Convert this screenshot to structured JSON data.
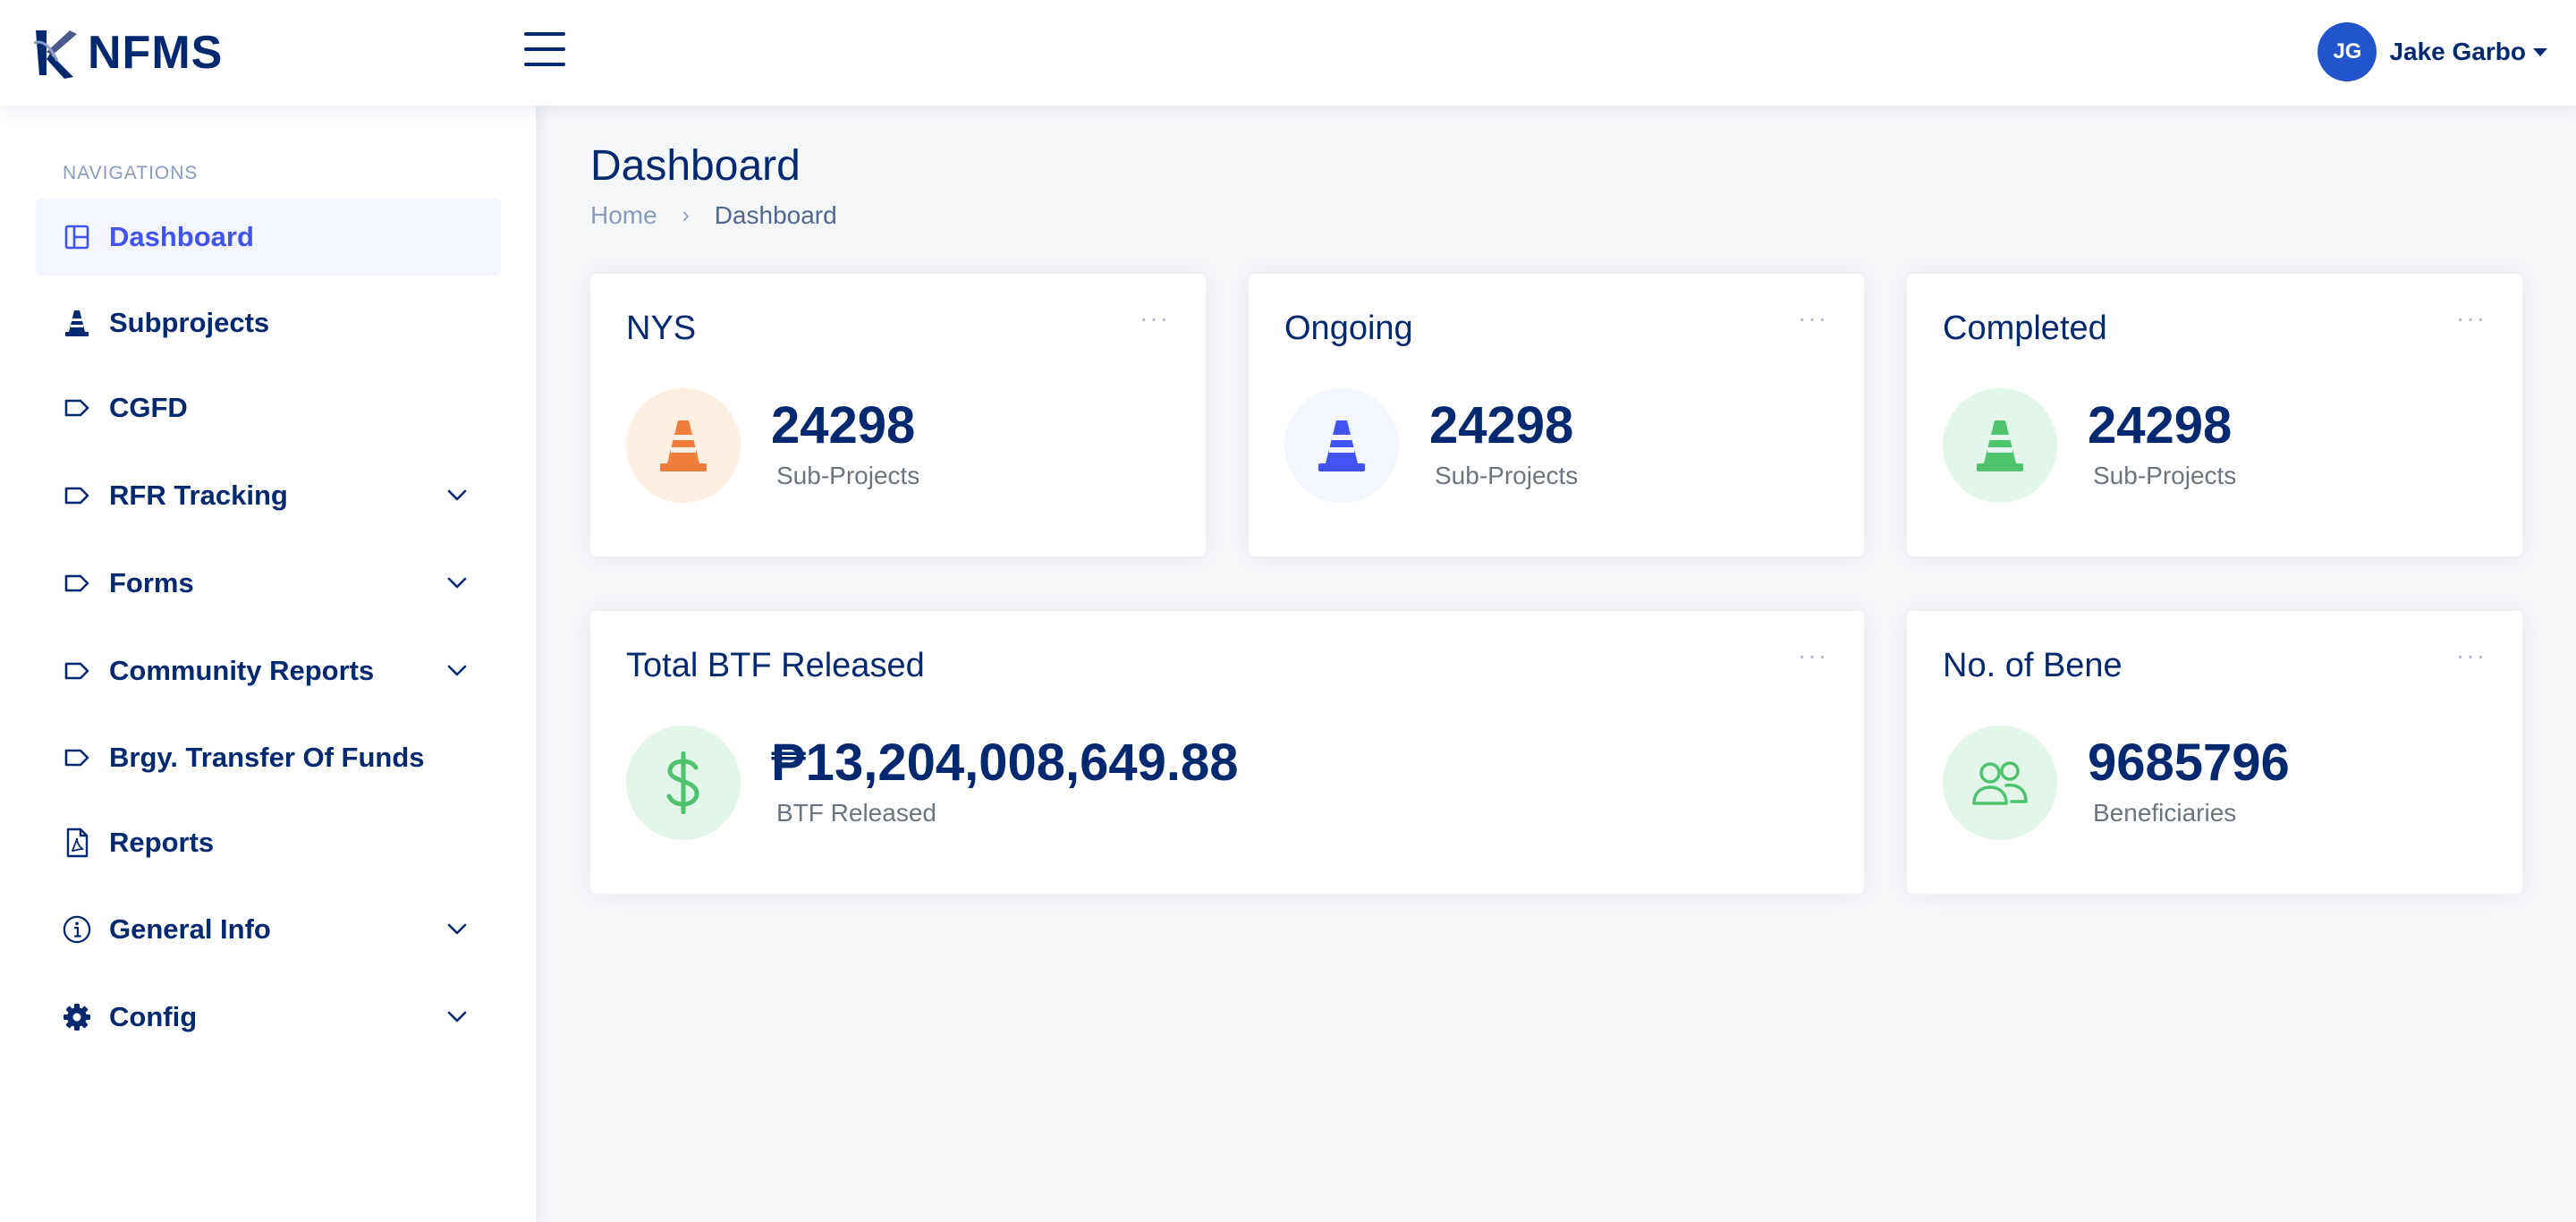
{
  "app": {
    "name": "NFMS"
  },
  "header": {
    "user": {
      "initials": "JG",
      "name": "Jake Garbo"
    }
  },
  "sidebar": {
    "heading": "NAVIGATIONS",
    "items": [
      {
        "label": "Dashboard",
        "icon": "grid-icon",
        "active": true,
        "expandable": false
      },
      {
        "label": "Subprojects",
        "icon": "cone-icon",
        "active": false,
        "expandable": false
      },
      {
        "label": "CGFD",
        "icon": "tag-icon",
        "active": false,
        "expandable": false
      },
      {
        "label": "RFR Tracking",
        "icon": "tag-icon",
        "active": false,
        "expandable": true
      },
      {
        "label": "Forms",
        "icon": "tag-icon",
        "active": false,
        "expandable": true
      },
      {
        "label": "Community Reports",
        "icon": "tag-icon",
        "active": false,
        "expandable": true
      },
      {
        "label": "Brgy. Transfer Of Funds",
        "icon": "tag-icon",
        "active": false,
        "expandable": false
      },
      {
        "label": "Reports",
        "icon": "pdf-file-icon",
        "active": false,
        "expandable": false
      },
      {
        "label": "General Info",
        "icon": "info-circle-icon",
        "active": false,
        "expandable": true
      },
      {
        "label": "Config",
        "icon": "gear-icon",
        "active": false,
        "expandable": true
      }
    ]
  },
  "page": {
    "title": "Dashboard",
    "breadcrumb": {
      "home": "Home",
      "current": "Dashboard"
    }
  },
  "cards": {
    "nys": {
      "title": "NYS",
      "value": "24298",
      "sub": "Sub-Projects",
      "icon": "cone-icon",
      "color": "#ee7d3b",
      "bg": "#fdeee2"
    },
    "ongoing": {
      "title": "Ongoing",
      "value": "24298",
      "sub": "Sub-Projects",
      "icon": "cone-icon",
      "color": "#4154f1",
      "bg": "#f4f6ff"
    },
    "completed": {
      "title": "Completed",
      "value": "24298",
      "sub": "Sub-Projects",
      "icon": "cone-icon",
      "color": "#4fc26e",
      "bg": "#e2f6e9"
    },
    "btf": {
      "title": "Total BTF Released",
      "value": "₱13,204,008,649.88",
      "sub": "BTF Released",
      "icon": "dollar-icon",
      "color": "#4fc26e",
      "bg": "#e2f6e9"
    },
    "bene": {
      "title": "No. of Bene",
      "value": "9685796",
      "sub": "Beneficiaries",
      "icon": "people-icon",
      "color": "#4fc26e",
      "bg": "#e2f6e9"
    },
    "menu_label": "···"
  }
}
